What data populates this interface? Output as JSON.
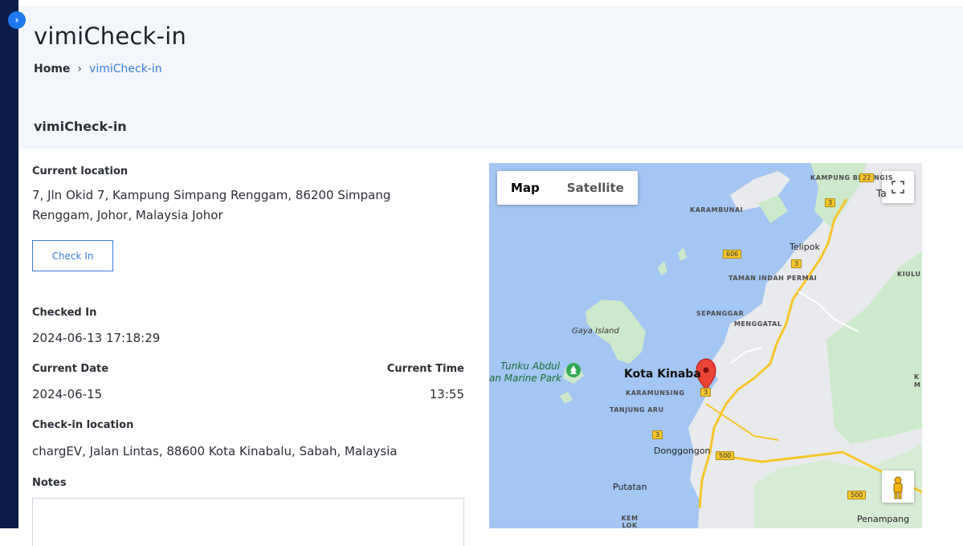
{
  "page": {
    "title": "vimiCheck-in",
    "breadcrumb": {
      "home": "Home",
      "separator": "›",
      "current": "vimiCheck-in"
    },
    "section_title": "vimiCheck-in"
  },
  "sidebar": {
    "toggle_icon": "chevron-right-icon",
    "toggle_glyph": "›",
    "bg_color": "#0c1c46",
    "toggle_color": "#1e78f0"
  },
  "checkin": {
    "current_location_label": "Current location",
    "current_location_value": "7, Jln Okid 7, Kampung Simpang Renggam, 86200 Simpang Renggam, Johor, Malaysia Johor",
    "check_in_button": "Check In",
    "checked_in_label": "Checked In",
    "checked_in_value": "2024-06-13 17:18:29",
    "current_date_label": "Current Date",
    "current_date_value": "2024-06-15",
    "current_time_label": "Current Time",
    "current_time_value": "13:55",
    "checkin_location_label": "Check-in location",
    "checkin_location_value": "chargEV, Jalan Lintas, 88600 Kota Kinabalu, Sabah, Malaysia",
    "notes_label": "Notes",
    "notes_value": ""
  },
  "map": {
    "type_map": "Map",
    "type_satellite": "Satellite",
    "fullscreen_icon": "fullscreen-icon",
    "pegman_icon": "street-view-pegman-icon",
    "marker_icon": "map-pin-icon",
    "labels": {
      "kampung_berungis": "KAMPUNG BERUNGIS",
      "ta": "Ta",
      "karambunai": "KARAMBUNAI",
      "telipok": "Telipok",
      "kiulu": "KIULU",
      "taman_indah_permai": "TAMAN INDAH PERMAI",
      "sepanggar": "SEPANGGAR",
      "menggatal": "MENGGATAL",
      "gaya_island": "Gaya Island",
      "tunku_abdul": "Tunku Abdul",
      "marine_park": "an Marine Park",
      "kota_kinabalu": "Kota Kinaba",
      "karamunsing": "KARAMUNSING",
      "tanjung_aru": "TANJUNG ARU",
      "donggongon": "Donggongon",
      "putatan": "Putatan",
      "kem_lok_kawi": "KEM LOK KAWI",
      "penampang": "Penampang",
      "k_edge": "K",
      "m_edge": "M"
    },
    "shields": {
      "r22": "22",
      "r3a": "3",
      "r3b": "3",
      "r606": "606",
      "r3c": "3",
      "r3d": "3",
      "r500a": "500",
      "r500b": "500"
    },
    "colors": {
      "water": "#a3c6f3",
      "land": "#e8eaed",
      "green": "#bfe3c3",
      "road": "#f7c52c",
      "marker": "#ea4335"
    }
  }
}
